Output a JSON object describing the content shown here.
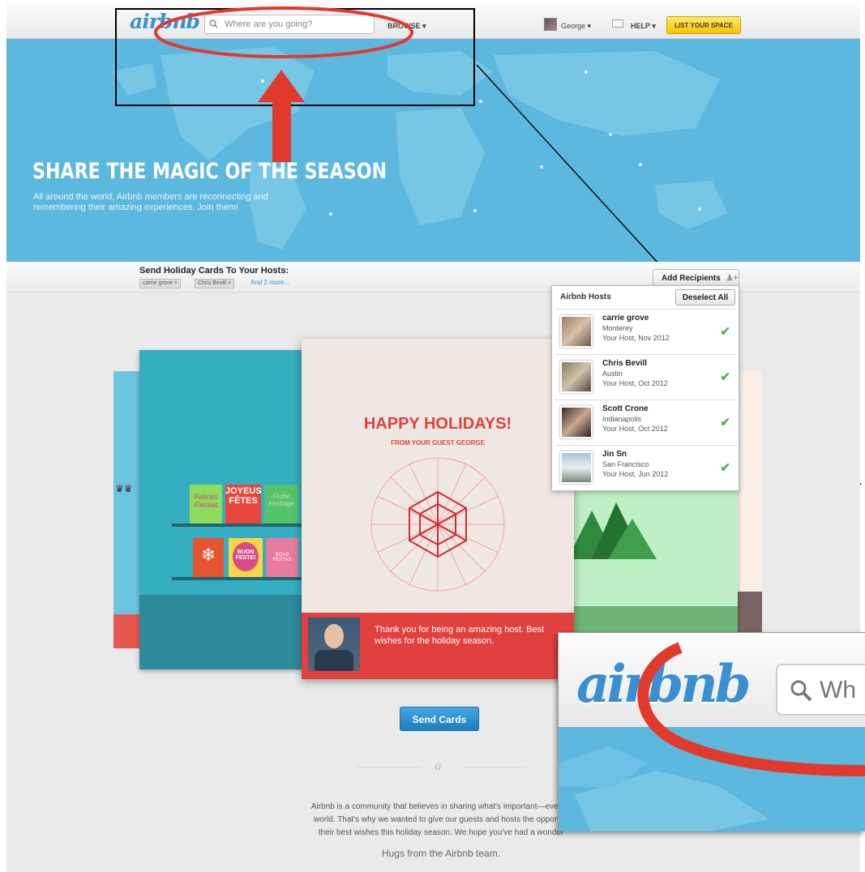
{
  "header": {
    "logo": "airbnb",
    "search_placeholder": "Where are you going?",
    "browse": "BROWSE ▾",
    "user": "George ▾",
    "help": "HELP ▾",
    "list_space": "LIST YOUR SPACE"
  },
  "hero": {
    "title": "SHARE THE MAGIC OF THE SEASON",
    "subtitle": "All around the world, Airbnb members are reconnecting and remembering their amazing experiences. Join them!"
  },
  "recipients": {
    "title": "Send Holiday Cards To Your Hosts:",
    "chips": [
      "carrie grove ×",
      "Chris Bevill ×"
    ],
    "more": "And 2 more...",
    "add_button": "Add Recipients"
  },
  "dropdown": {
    "title": "Airbnb Hosts",
    "deselect": "Deselect All",
    "hosts": [
      {
        "name": "carrie grove",
        "city": "Monterey",
        "info": "Your Host, Nov 2012"
      },
      {
        "name": "Chris Bevill",
        "city": "Austin",
        "info": "Your Host, Oct 2012"
      },
      {
        "name": "Scott Crone",
        "city": "Indianapolis",
        "info": "Your Host, Oct 2012"
      },
      {
        "name": "Jin Sn",
        "city": "San Francisco",
        "info": "Your Host, Jun 2012"
      }
    ]
  },
  "card": {
    "title": "HAPPY HOLIDAYS!",
    "subtitle": "FROM YOUR GUEST GEORGE",
    "message": "Thank you for being an amazing host. Best wishes for the holiday season.",
    "left_card_signs": [
      "Felices Fiestas",
      "JOYEUSES FÊTES",
      "Frohe Festtage",
      "BUON FESTE!",
      "BOAS FESTAS"
    ]
  },
  "send_button": "Send Cards",
  "footer_logo": "a",
  "about_text": "Airbnb is a community that believes in sharing what's important—everywhere in the world. That's why we wanted to give our guests and hosts the opportunity to share their best wishes this holiday season. We hope you've had a wonderful year.",
  "about_visible": [
    "Airbnb is a community that believes in sharing what's important—everyw",
    "world. That's why we wanted to give our guests and hosts the opportun",
    "their best wishes this holiday season. We hope you've had a wonder"
  ],
  "hugs": "Hugs from the Airbnb team.",
  "zoom": {
    "logo": "airbnb",
    "search_text": "Wh"
  },
  "colors": {
    "hero": "#5cb8df",
    "accent_red": "#e2403e",
    "annotation_red": "#e03a2c",
    "check_green": "#50b64a",
    "send_blue": "#2a8fd4"
  }
}
